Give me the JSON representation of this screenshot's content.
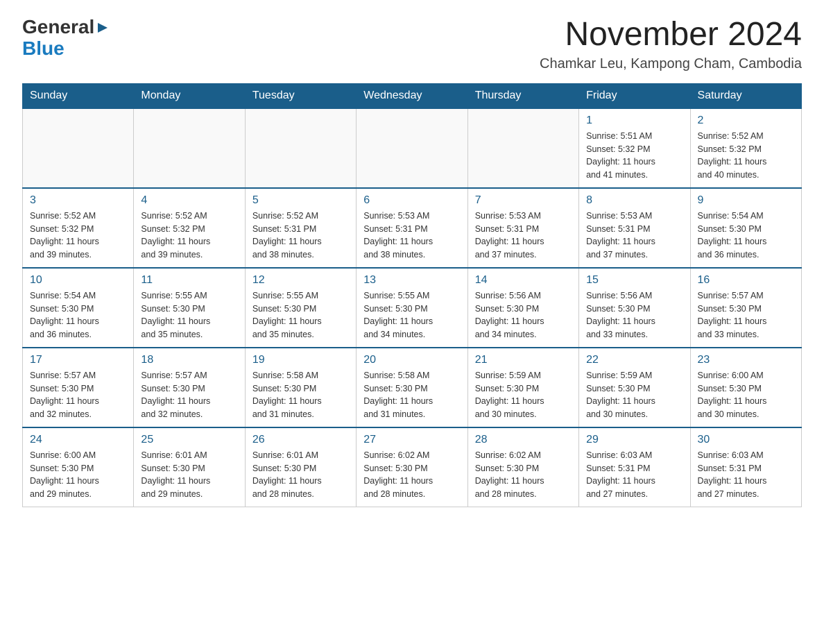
{
  "header": {
    "logo": {
      "general": "General",
      "blue": "Blue"
    },
    "title": "November 2024",
    "location": "Chamkar Leu, Kampong Cham, Cambodia"
  },
  "calendar": {
    "days_of_week": [
      "Sunday",
      "Monday",
      "Tuesday",
      "Wednesday",
      "Thursday",
      "Friday",
      "Saturday"
    ],
    "weeks": [
      {
        "days": [
          {
            "number": "",
            "info": ""
          },
          {
            "number": "",
            "info": ""
          },
          {
            "number": "",
            "info": ""
          },
          {
            "number": "",
            "info": ""
          },
          {
            "number": "",
            "info": ""
          },
          {
            "number": "1",
            "info": "Sunrise: 5:51 AM\nSunset: 5:32 PM\nDaylight: 11 hours\nand 41 minutes."
          },
          {
            "number": "2",
            "info": "Sunrise: 5:52 AM\nSunset: 5:32 PM\nDaylight: 11 hours\nand 40 minutes."
          }
        ]
      },
      {
        "days": [
          {
            "number": "3",
            "info": "Sunrise: 5:52 AM\nSunset: 5:32 PM\nDaylight: 11 hours\nand 39 minutes."
          },
          {
            "number": "4",
            "info": "Sunrise: 5:52 AM\nSunset: 5:32 PM\nDaylight: 11 hours\nand 39 minutes."
          },
          {
            "number": "5",
            "info": "Sunrise: 5:52 AM\nSunset: 5:31 PM\nDaylight: 11 hours\nand 38 minutes."
          },
          {
            "number": "6",
            "info": "Sunrise: 5:53 AM\nSunset: 5:31 PM\nDaylight: 11 hours\nand 38 minutes."
          },
          {
            "number": "7",
            "info": "Sunrise: 5:53 AM\nSunset: 5:31 PM\nDaylight: 11 hours\nand 37 minutes."
          },
          {
            "number": "8",
            "info": "Sunrise: 5:53 AM\nSunset: 5:31 PM\nDaylight: 11 hours\nand 37 minutes."
          },
          {
            "number": "9",
            "info": "Sunrise: 5:54 AM\nSunset: 5:30 PM\nDaylight: 11 hours\nand 36 minutes."
          }
        ]
      },
      {
        "days": [
          {
            "number": "10",
            "info": "Sunrise: 5:54 AM\nSunset: 5:30 PM\nDaylight: 11 hours\nand 36 minutes."
          },
          {
            "number": "11",
            "info": "Sunrise: 5:55 AM\nSunset: 5:30 PM\nDaylight: 11 hours\nand 35 minutes."
          },
          {
            "number": "12",
            "info": "Sunrise: 5:55 AM\nSunset: 5:30 PM\nDaylight: 11 hours\nand 35 minutes."
          },
          {
            "number": "13",
            "info": "Sunrise: 5:55 AM\nSunset: 5:30 PM\nDaylight: 11 hours\nand 34 minutes."
          },
          {
            "number": "14",
            "info": "Sunrise: 5:56 AM\nSunset: 5:30 PM\nDaylight: 11 hours\nand 34 minutes."
          },
          {
            "number": "15",
            "info": "Sunrise: 5:56 AM\nSunset: 5:30 PM\nDaylight: 11 hours\nand 33 minutes."
          },
          {
            "number": "16",
            "info": "Sunrise: 5:57 AM\nSunset: 5:30 PM\nDaylight: 11 hours\nand 33 minutes."
          }
        ]
      },
      {
        "days": [
          {
            "number": "17",
            "info": "Sunrise: 5:57 AM\nSunset: 5:30 PM\nDaylight: 11 hours\nand 32 minutes."
          },
          {
            "number": "18",
            "info": "Sunrise: 5:57 AM\nSunset: 5:30 PM\nDaylight: 11 hours\nand 32 minutes."
          },
          {
            "number": "19",
            "info": "Sunrise: 5:58 AM\nSunset: 5:30 PM\nDaylight: 11 hours\nand 31 minutes."
          },
          {
            "number": "20",
            "info": "Sunrise: 5:58 AM\nSunset: 5:30 PM\nDaylight: 11 hours\nand 31 minutes."
          },
          {
            "number": "21",
            "info": "Sunrise: 5:59 AM\nSunset: 5:30 PM\nDaylight: 11 hours\nand 30 minutes."
          },
          {
            "number": "22",
            "info": "Sunrise: 5:59 AM\nSunset: 5:30 PM\nDaylight: 11 hours\nand 30 minutes."
          },
          {
            "number": "23",
            "info": "Sunrise: 6:00 AM\nSunset: 5:30 PM\nDaylight: 11 hours\nand 30 minutes."
          }
        ]
      },
      {
        "days": [
          {
            "number": "24",
            "info": "Sunrise: 6:00 AM\nSunset: 5:30 PM\nDaylight: 11 hours\nand 29 minutes."
          },
          {
            "number": "25",
            "info": "Sunrise: 6:01 AM\nSunset: 5:30 PM\nDaylight: 11 hours\nand 29 minutes."
          },
          {
            "number": "26",
            "info": "Sunrise: 6:01 AM\nSunset: 5:30 PM\nDaylight: 11 hours\nand 28 minutes."
          },
          {
            "number": "27",
            "info": "Sunrise: 6:02 AM\nSunset: 5:30 PM\nDaylight: 11 hours\nand 28 minutes."
          },
          {
            "number": "28",
            "info": "Sunrise: 6:02 AM\nSunset: 5:30 PM\nDaylight: 11 hours\nand 28 minutes."
          },
          {
            "number": "29",
            "info": "Sunrise: 6:03 AM\nSunset: 5:31 PM\nDaylight: 11 hours\nand 27 minutes."
          },
          {
            "number": "30",
            "info": "Sunrise: 6:03 AM\nSunset: 5:31 PM\nDaylight: 11 hours\nand 27 minutes."
          }
        ]
      }
    ]
  }
}
